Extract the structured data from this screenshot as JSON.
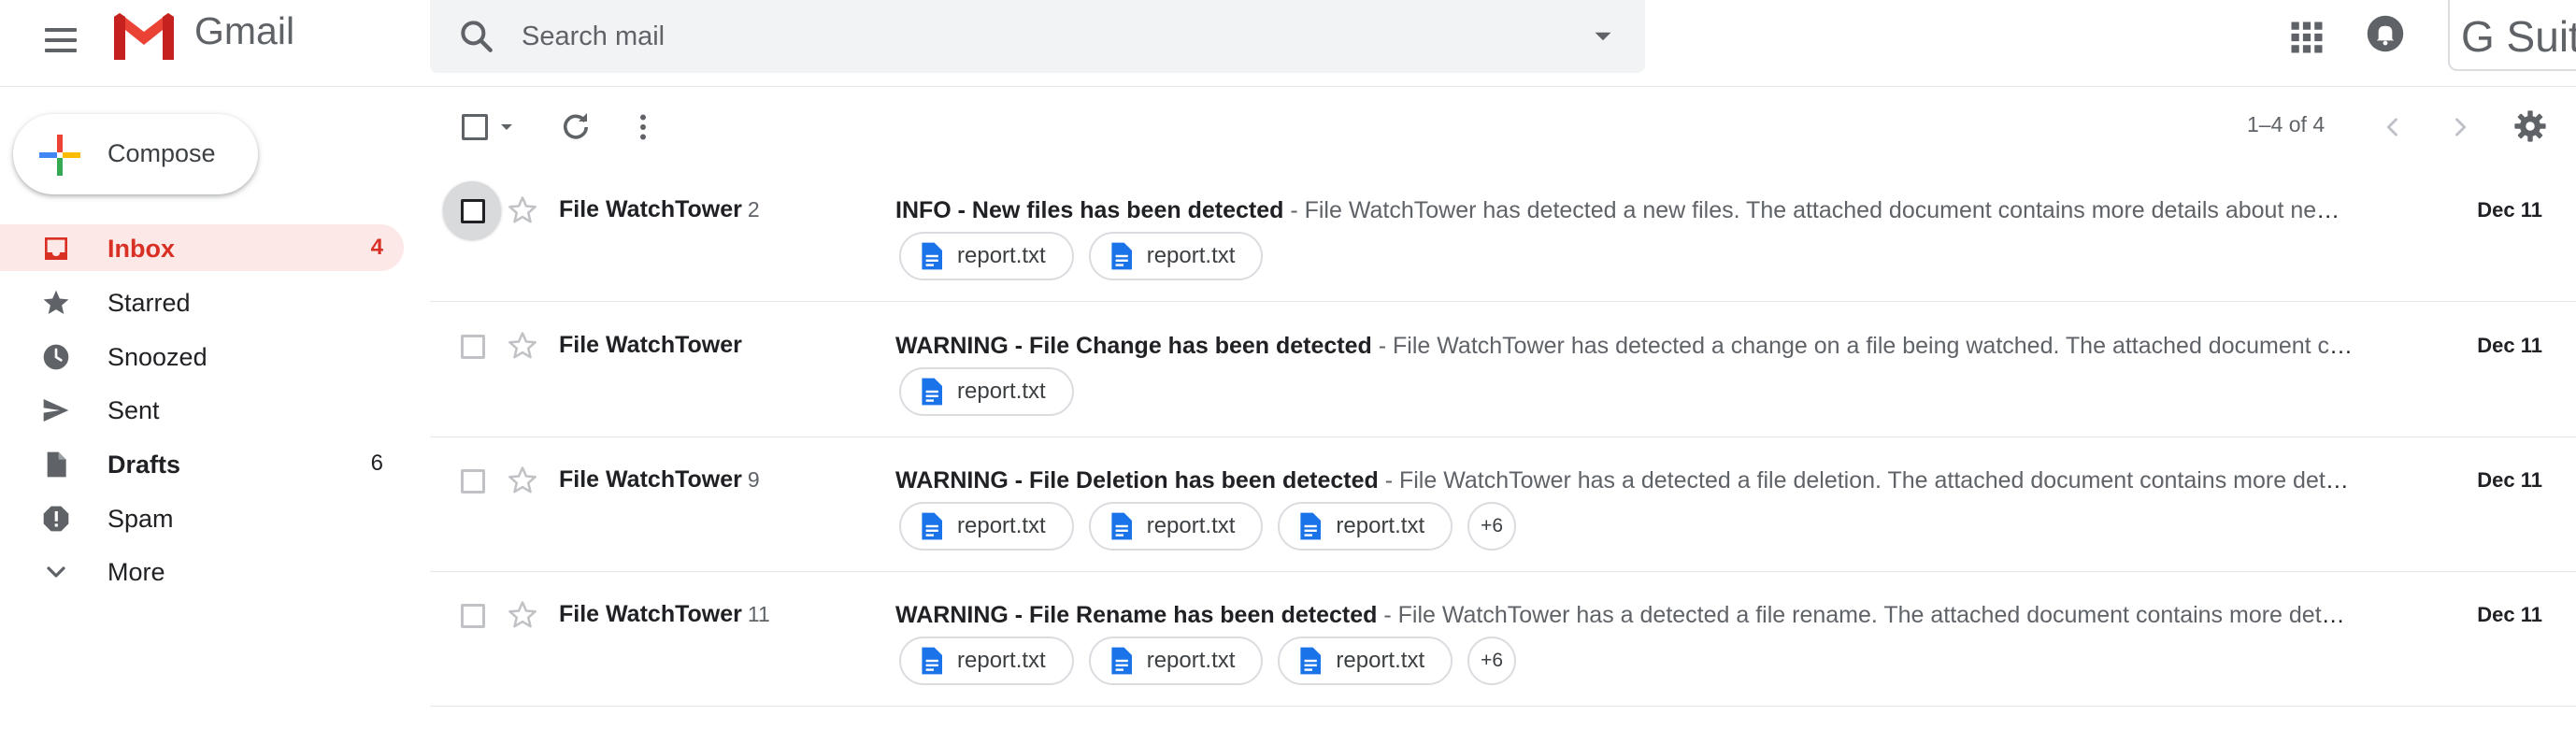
{
  "app": {
    "name": "Gmail",
    "suite_label": "G Suite"
  },
  "search": {
    "placeholder": "Search mail"
  },
  "compose": {
    "label": "Compose"
  },
  "sidebar": {
    "items": [
      {
        "label": "Inbox",
        "count": "4",
        "icon": "inbox-icon"
      },
      {
        "label": "Starred",
        "count": "",
        "icon": "star-icon"
      },
      {
        "label": "Snoozed",
        "count": "",
        "icon": "clock-icon"
      },
      {
        "label": "Sent",
        "count": "",
        "icon": "send-icon"
      },
      {
        "label": "Drafts",
        "count": "6",
        "icon": "draft-icon"
      },
      {
        "label": "Spam",
        "count": "",
        "icon": "spam-icon"
      },
      {
        "label": "More",
        "count": "",
        "icon": "chevron-down-icon"
      }
    ]
  },
  "toolbar": {
    "range": "1–4 of 4"
  },
  "emails": [
    {
      "sender": "File WatchTower",
      "count": "2",
      "subject": "INFO - New files has been detected",
      "snippet": " - File WatchTower has detected a new files. The attached document contains more details about new files.",
      "date": "Dec 11",
      "attachments": [
        "report.txt",
        "report.txt"
      ],
      "more": ""
    },
    {
      "sender": "File WatchTower",
      "count": "",
      "subject": "WARNING - File Change has been detected",
      "snippet": " - File WatchTower has detected a change on a file being watched. The attached document contains more details.",
      "date": "Dec 11",
      "attachments": [
        "report.txt"
      ],
      "more": ""
    },
    {
      "sender": "File WatchTower",
      "count": "9",
      "subject": "WARNING - File Deletion has been detected",
      "snippet": " - File WatchTower has a detected a file deletion. The attached document contains more details about deletion.",
      "date": "Dec 11",
      "attachments": [
        "report.txt",
        "report.txt",
        "report.txt"
      ],
      "more": "+6"
    },
    {
      "sender": "File WatchTower",
      "count": "11",
      "subject": "WARNING - File Rename has been detected",
      "snippet": " - File WatchTower has a detected a file rename. The attached document contains more details about rename.",
      "date": "Dec 11",
      "attachments": [
        "report.txt",
        "report.txt",
        "report.txt"
      ],
      "more": "+6"
    }
  ],
  "colors": {
    "accent_red": "#d93025",
    "inbox_bg": "#fce8e6",
    "attachment_icon": "#1a73e8"
  }
}
